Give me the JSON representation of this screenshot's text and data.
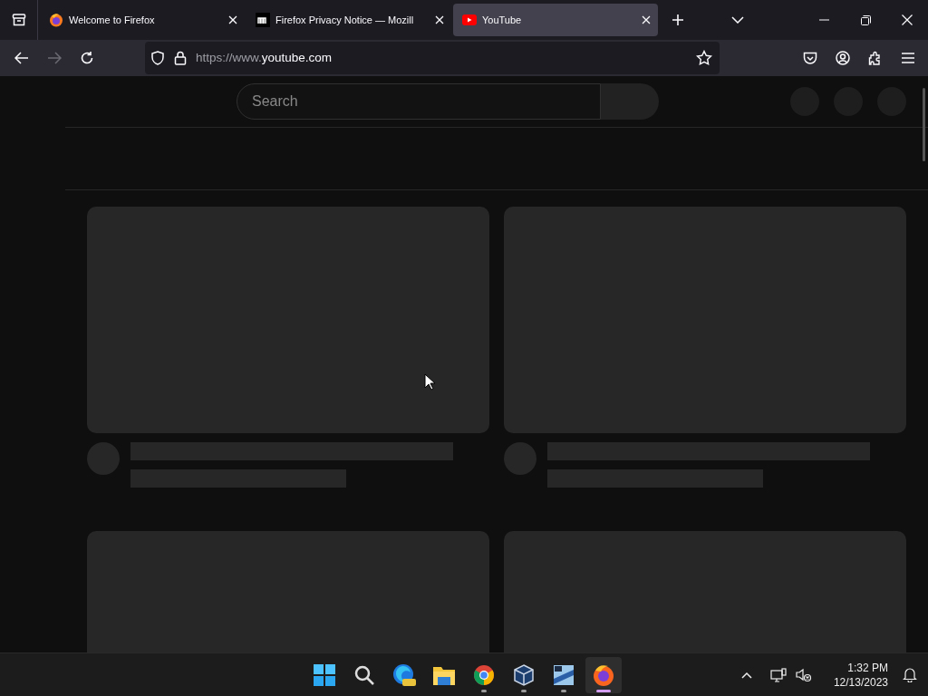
{
  "tabs": [
    {
      "label": "Welcome to Firefox",
      "kind": "firefox",
      "selected": false
    },
    {
      "label": "Firefox Privacy Notice — Mozill",
      "kind": "mozilla",
      "selected": false
    },
    {
      "label": "YouTube",
      "kind": "youtube",
      "selected": true
    }
  ],
  "address_bar": {
    "url_prefix": "https://www.",
    "url_domain": "youtube.com"
  },
  "page": {
    "search": {
      "placeholder": "Search"
    }
  },
  "taskbar": {
    "apps": [
      {
        "kind": "start",
        "running": false,
        "active": false
      },
      {
        "kind": "search",
        "running": false,
        "active": false
      },
      {
        "kind": "edge",
        "running": false,
        "active": false
      },
      {
        "kind": "folder",
        "running": false,
        "active": false
      },
      {
        "kind": "chrome",
        "running": true,
        "active": false
      },
      {
        "kind": "virtualbox",
        "running": true,
        "active": false
      },
      {
        "kind": "vista",
        "running": true,
        "active": false
      },
      {
        "kind": "firefox",
        "running": true,
        "active": true
      }
    ],
    "time": "1:32 PM",
    "date": "12/13/2023"
  }
}
